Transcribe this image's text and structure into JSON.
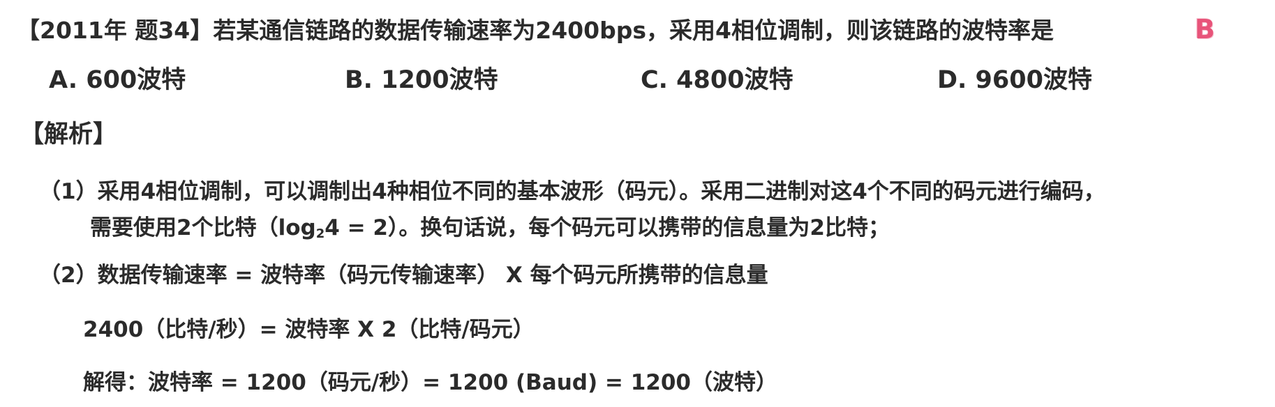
{
  "question": {
    "stem": "【2011年 题34】若某通信链路的数据传输速率为2400bps，采用4相位调制，则该链路的波特率是",
    "answer_mark": "B",
    "options": [
      "A. 600波特",
      "B. 1200波特",
      "C. 4800波特",
      "D. 9600波特"
    ]
  },
  "analysis": {
    "heading": "【解析】",
    "point1_line1": "（1）采用4相位调制，可以调制出4种相位不同的基本波形（码元）。采用二进制对这4个不同的码元进行编码，",
    "point1_line2_pre": "需要使用2个比特（log",
    "point1_line2_sub": "2",
    "point1_line2_post": "4 = 2）。换句话说，每个码元可以携带的信息量为2比特；",
    "point2": "（2）数据传输速率 = 波特率（码元传输速率） X  每个码元所携带的信息量",
    "equation1": "2400（比特/秒）= 波特率  X  2（比特/码元）",
    "equation2": "解得：波特率 = 1200（码元/秒）= 1200 (Baud) = 1200（波特）"
  },
  "colors": {
    "text": "#2b2b2b",
    "answer_mark": "#e8547a"
  }
}
